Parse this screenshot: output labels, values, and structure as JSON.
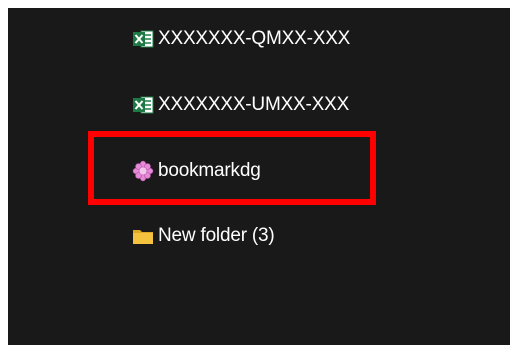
{
  "file_list": {
    "items": [
      {
        "name": "XXXXXXX-QMXX-XXX",
        "icon": "excel-file-icon"
      },
      {
        "name": "XXXXXXX-UMXX-XXX",
        "icon": "excel-file-icon"
      },
      {
        "name": "bookmarkdg",
        "icon": "bookmark-flower-icon"
      },
      {
        "name": "New folder (3)",
        "icon": "folder-icon"
      }
    ]
  },
  "colors": {
    "background": "#191919",
    "text": "#ffffff",
    "highlight_border": "#ff0000",
    "excel_green": "#1d7a45",
    "folder_yellow": "#f5c240",
    "bookmark_pink": "#e58ad6"
  }
}
